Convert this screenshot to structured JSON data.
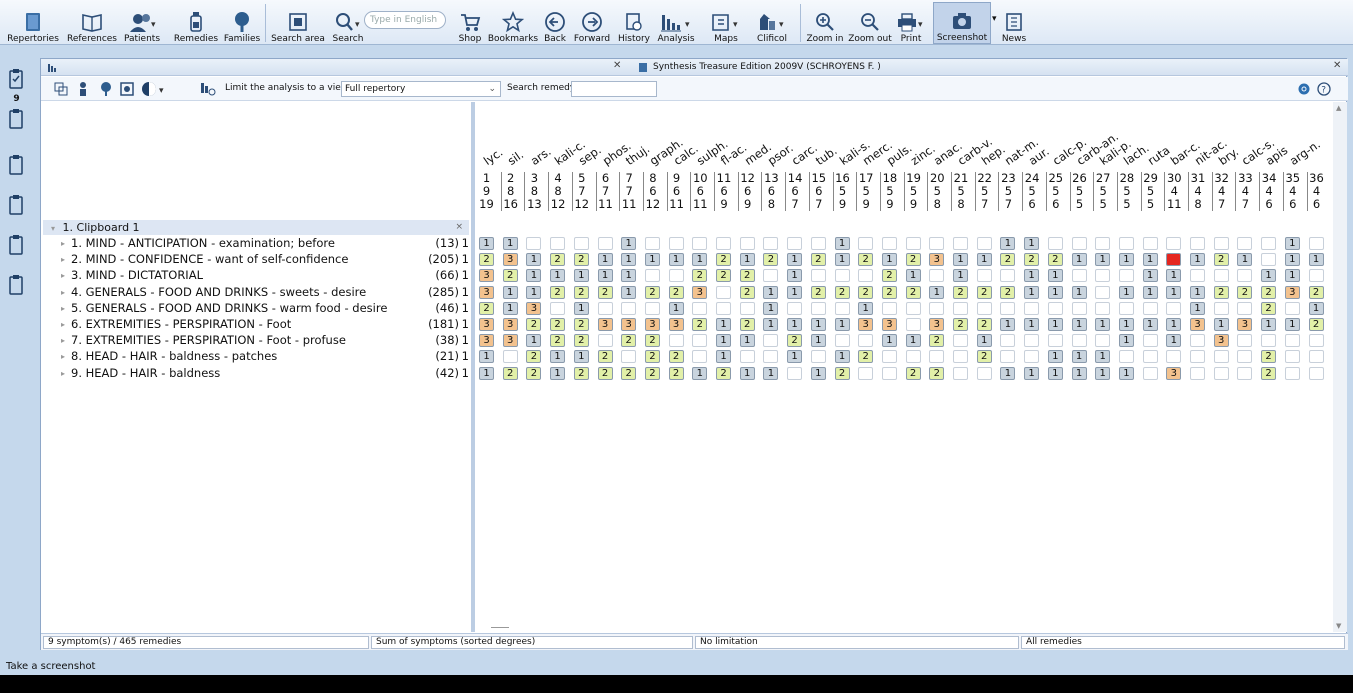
{
  "toolbar": {
    "buttons": [
      {
        "label": "Repertories"
      },
      {
        "label": "References"
      },
      {
        "label": "Patients"
      },
      {
        "label": "Remedies"
      },
      {
        "label": "Families"
      },
      {
        "label": "Search area"
      },
      {
        "label": "Search"
      },
      {
        "label": "Shop"
      },
      {
        "label": "Bookmarks"
      },
      {
        "label": "Back"
      },
      {
        "label": "Forward"
      },
      {
        "label": "History"
      },
      {
        "label": "Analysis"
      },
      {
        "label": "Maps"
      },
      {
        "label": "Clificol"
      },
      {
        "label": "Zoom in"
      },
      {
        "label": "Zoom out"
      },
      {
        "label": "Print"
      },
      {
        "label": "Screenshot"
      },
      {
        "label": "News"
      }
    ],
    "search_placeholder": "Type in English"
  },
  "left_sidebar": {
    "clipboard_count": "9"
  },
  "tabs": {
    "tab2_title": "Synthesis Treasure Edition 2009V (SCHROYENS F. )"
  },
  "analysis_toolbar": {
    "limit_label": "Limit the analysis to a view:",
    "view_value": "Full repertory",
    "search_remedy_label": "Search remedy:"
  },
  "clipboard_title": "1. Clipboard 1",
  "rubrics": [
    {
      "label": "1. MIND - ANTICIPATION - examination; before",
      "count": "(13)",
      "weight": "1"
    },
    {
      "label": "2. MIND - CONFIDENCE - want of self-confidence",
      "count": "(205)",
      "weight": "1"
    },
    {
      "label": "3. MIND - DICTATORIAL",
      "count": "(66)",
      "weight": "1"
    },
    {
      "label": "4. GENERALS - FOOD AND DRINKS - sweets - desire",
      "count": "(285)",
      "weight": "1"
    },
    {
      "label": "5. GENERALS - FOOD AND DRINKS - warm food - desire",
      "count": "(46)",
      "weight": "1"
    },
    {
      "label": "6. EXTREMITIES - PERSPIRATION - Foot",
      "count": "(181)",
      "weight": "1"
    },
    {
      "label": "7. EXTREMITIES - PERSPIRATION - Foot - profuse",
      "count": "(38)",
      "weight": "1"
    },
    {
      "label": "8. HEAD - HAIR - baldness - patches",
      "count": "(21)",
      "weight": "1"
    },
    {
      "label": "9. HEAD - HAIR - baldness",
      "count": "(42)",
      "weight": "1"
    }
  ],
  "remedies": [
    "lyc.",
    "sil.",
    "ars.",
    "kali-c.",
    "sep.",
    "phos.",
    "thuj.",
    "graph.",
    "calc.",
    "sulph.",
    "fl-ac.",
    "med.",
    "psor.",
    "carc.",
    "tub.",
    "kali-s.",
    "merc.",
    "puls.",
    "zinc.",
    "anac.",
    "carb-v.",
    "hep.",
    "nat-m.",
    "aur.",
    "calc-p.",
    "carb-an.",
    "kali-p.",
    "lach.",
    "ruta",
    "bar-c.",
    "nit-ac.",
    "bry.",
    "calc-s.",
    "apis",
    "arg-n."
  ],
  "rank": [
    "1",
    "2",
    "3",
    "4",
    "5",
    "6",
    "7",
    "8",
    "9",
    "10",
    "11",
    "12",
    "13",
    "14",
    "15",
    "16",
    "17",
    "18",
    "19",
    "20",
    "21",
    "22",
    "23",
    "24",
    "25",
    "26",
    "27",
    "28",
    "29",
    "30",
    "31",
    "32",
    "33",
    "34",
    "35",
    "36"
  ],
  "symptoms_covered": [
    "9",
    "8",
    "8",
    "8",
    "7",
    "7",
    "7",
    "6",
    "6",
    "6",
    "6",
    "6",
    "6",
    "6",
    "6",
    "5",
    "5",
    "5",
    "5",
    "5",
    "5",
    "5",
    "5",
    "5",
    "5",
    "5",
    "5",
    "5",
    "5",
    "4",
    "4",
    "4",
    "4",
    "4",
    "4",
    "4"
  ],
  "degree_sum": [
    "19",
    "16",
    "13",
    "12",
    "12",
    "11",
    "11",
    "12",
    "11",
    "11",
    "9",
    "9",
    "8",
    "7",
    "7",
    "9",
    "9",
    "9",
    "9",
    "8",
    "8",
    "7",
    "7",
    "6",
    "6",
    "5",
    "5",
    "5",
    "5",
    "11",
    "8",
    "7",
    "7",
    "6",
    "6",
    "6"
  ],
  "grades": [
    "110000100000000100000011000000000010",
    "231221111121212121231122211114121011",
    "321111100222010002101001100011000110",
    "311222122302112222212221110111122232",
    "213010001000100010000000000000100201",
    "332223333212111133032211111111313112",
    "331220220011021001120100000101030000",
    "102112022010010120000200111000000200",
    "122122222121101200220011111103000200"
  ],
  "grade_colors": {
    "1": "#c9d4de",
    "2": "#e2f0a8",
    "3": "#f3c28e",
    "4": "#e5261f"
  },
  "status": {
    "summary": "9 symptom(s) / 465 remedies",
    "sorting": "Sum of symptoms (sorted degrees)",
    "limitation": "No limitation",
    "remedy_filter": "All remedies"
  },
  "status_line": "Take a screenshot"
}
